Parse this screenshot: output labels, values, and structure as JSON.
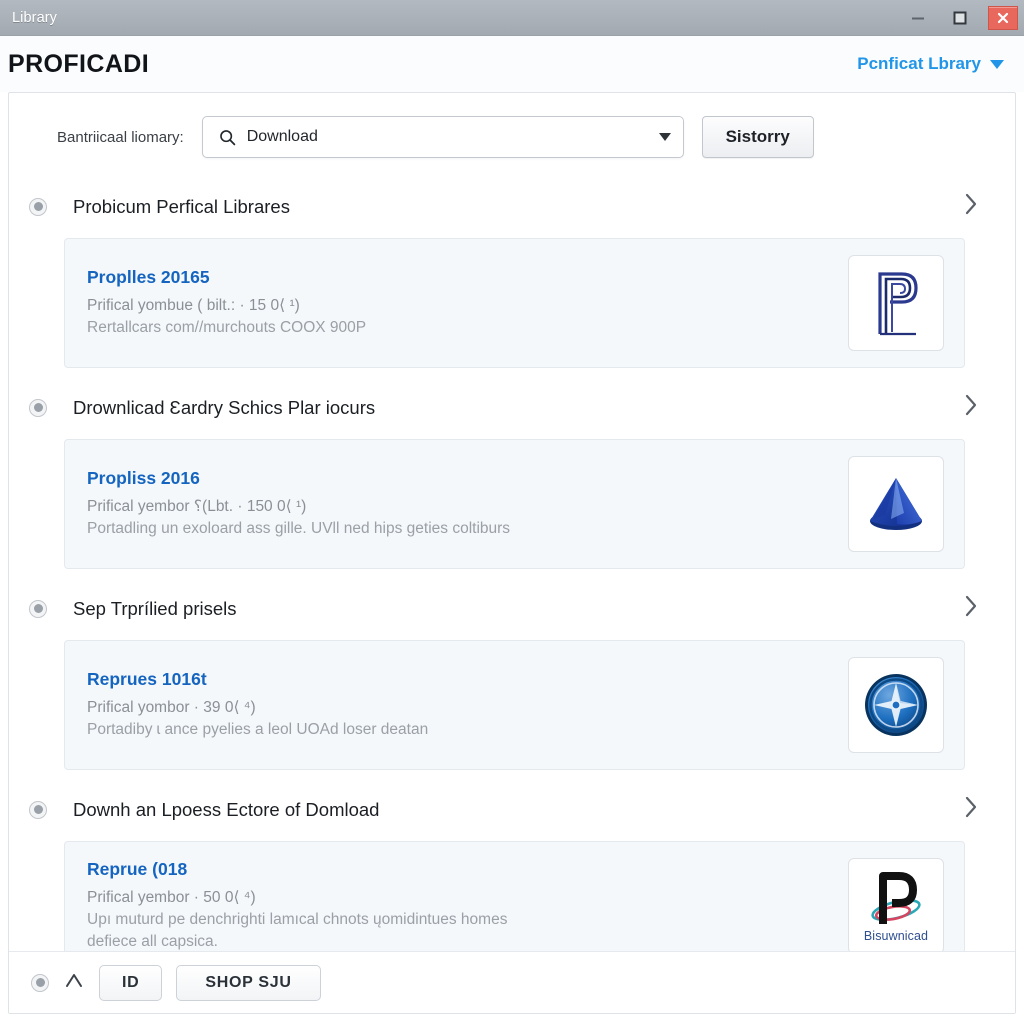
{
  "window": {
    "title": "Library",
    "controls": {
      "minimize": "minimize-icon",
      "maximize": "maximize-icon",
      "close": "close-icon"
    }
  },
  "header": {
    "app_title": "PROFICADI",
    "link_label": "Pcnficat Lbrary",
    "link_color": "#2196e8",
    "caret": "chevron-down-icon"
  },
  "search": {
    "label": "Bantriicaal liomary:",
    "icon": "search-icon",
    "value": "Download",
    "placeholder": "Download",
    "dropdown_caret": "chevron-down-icon",
    "history_button": "Sistorry"
  },
  "sections": [
    {
      "title": "Probicum Perfical Librares",
      "bullet": "radio-selected-icon",
      "chevron": "chevron-right-icon",
      "card": {
        "title": "Proplles 20165",
        "line2": "Prifical yombue ( bilt.: · 15 0⟨ ¹)",
        "line3": "Rertallcars com//murchouts COOX 900P",
        "thumb": "letter-p-outline-icon",
        "thumb_label": ""
      }
    },
    {
      "title": "Drownlicad Ɛardry Schics Plar iocurs",
      "bullet": "radio-selected-icon",
      "chevron": "chevron-right-icon",
      "card": {
        "title": "Propliss 2016",
        "line2": "Prifical yembor ⸮(Lbt. · 150 0⟨ ¹)",
        "line3": "Portadling un exoloard ass gille. UVll ned hips geties coltiburs",
        "thumb": "blue-cone-icon",
        "thumb_label": ""
      }
    },
    {
      "title": "Sep Trprílied prisels",
      "bullet": "radio-selected-icon",
      "chevron": "chevron-right-icon",
      "card": {
        "title": "Reprues 1016t",
        "line2": "Prifical yombor · 39 0⟨ ⁴)",
        "line3": "Portadiby ɩ ance pyelies a leol UOAd loser deatan",
        "thumb": "blue-seal-compass-icon",
        "thumb_label": ""
      }
    },
    {
      "title": "Downh an Lpoess Ectore of Domload",
      "bullet": "radio-selected-icon",
      "chevron": "chevron-right-icon",
      "card": {
        "title": "Reprue (018",
        "line2": "Prifical yembor · 50 0⟨ ⁴)",
        "line3": "Upı muturd pe denchrighti lamıcal chnots ųomidintues homes",
        "line4": "defiece all capsica.",
        "thumb": "letter-p-orbit-icon",
        "thumb_label": "Bisuwnicad"
      }
    }
  ],
  "footer": {
    "bullet": "radio-selected-icon",
    "chevron_up": "chevron-up-icon",
    "buttons": [
      {
        "label": "ID"
      },
      {
        "label": "SHOP SJU"
      }
    ]
  }
}
